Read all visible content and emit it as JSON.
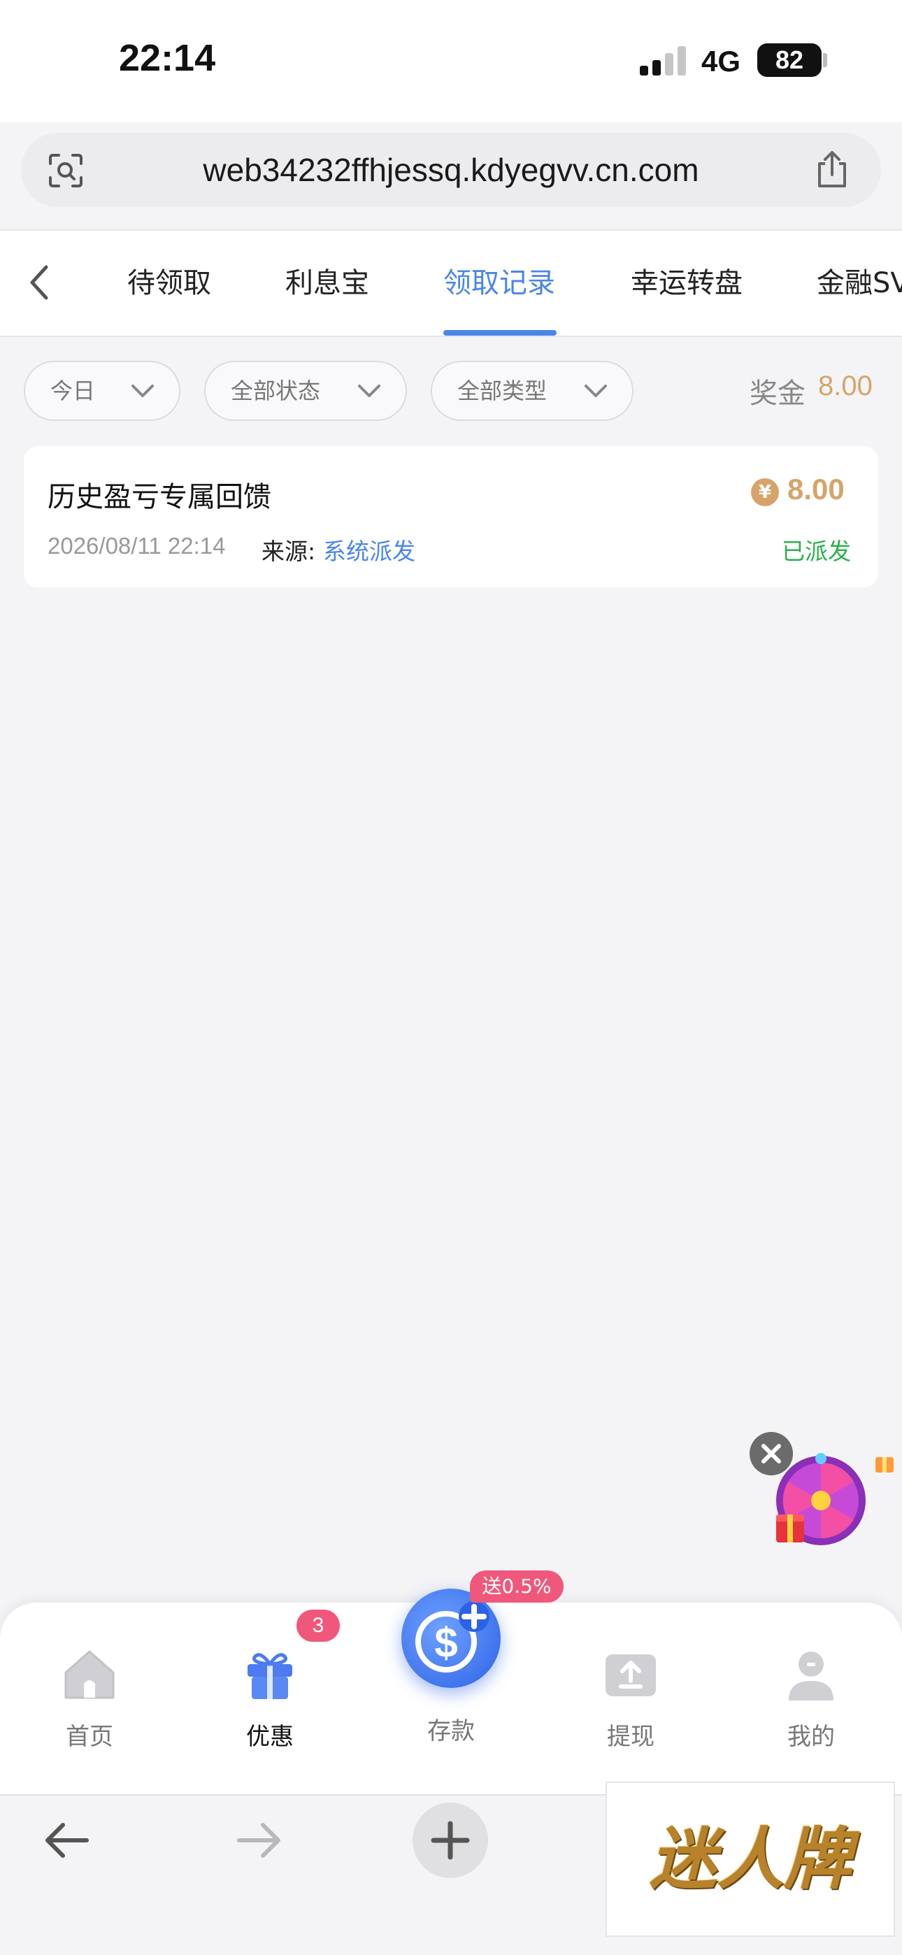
{
  "status_bar": {
    "time": "22:14",
    "network": "4G",
    "battery": "82"
  },
  "url_bar": {
    "url": "web34232ffhjessq.kdyegvv.cn.com"
  },
  "tabs": [
    {
      "label": "待领取"
    },
    {
      "label": "利息宝"
    },
    {
      "label": "领取记录",
      "active": true
    },
    {
      "label": "幸运转盘"
    },
    {
      "label": "金融SVIP"
    }
  ],
  "filters": {
    "date": "今日",
    "status": "全部状态",
    "type": "全部类型"
  },
  "bonus": {
    "label": "奖金",
    "value": "8.00"
  },
  "records": [
    {
      "title": "历史盈亏专属回馈",
      "coin_symbol": "¥",
      "amount": "8.00",
      "datetime": "2026/08/11 22:14",
      "source_label": "来源:",
      "source": "系统派发",
      "status": "已派发"
    }
  ],
  "bottom_nav": {
    "home": "首页",
    "promo": "优惠",
    "promo_badge": "3",
    "deposit": "存款",
    "deposit_tag": "送0.5%",
    "withdraw": "提现",
    "mine": "我的"
  },
  "watermark": {
    "text": "迷人牌"
  },
  "colors": {
    "accent": "#4a86e8",
    "gold": "#d6a46a",
    "success": "#29b14a",
    "badge": "#f0587b"
  }
}
